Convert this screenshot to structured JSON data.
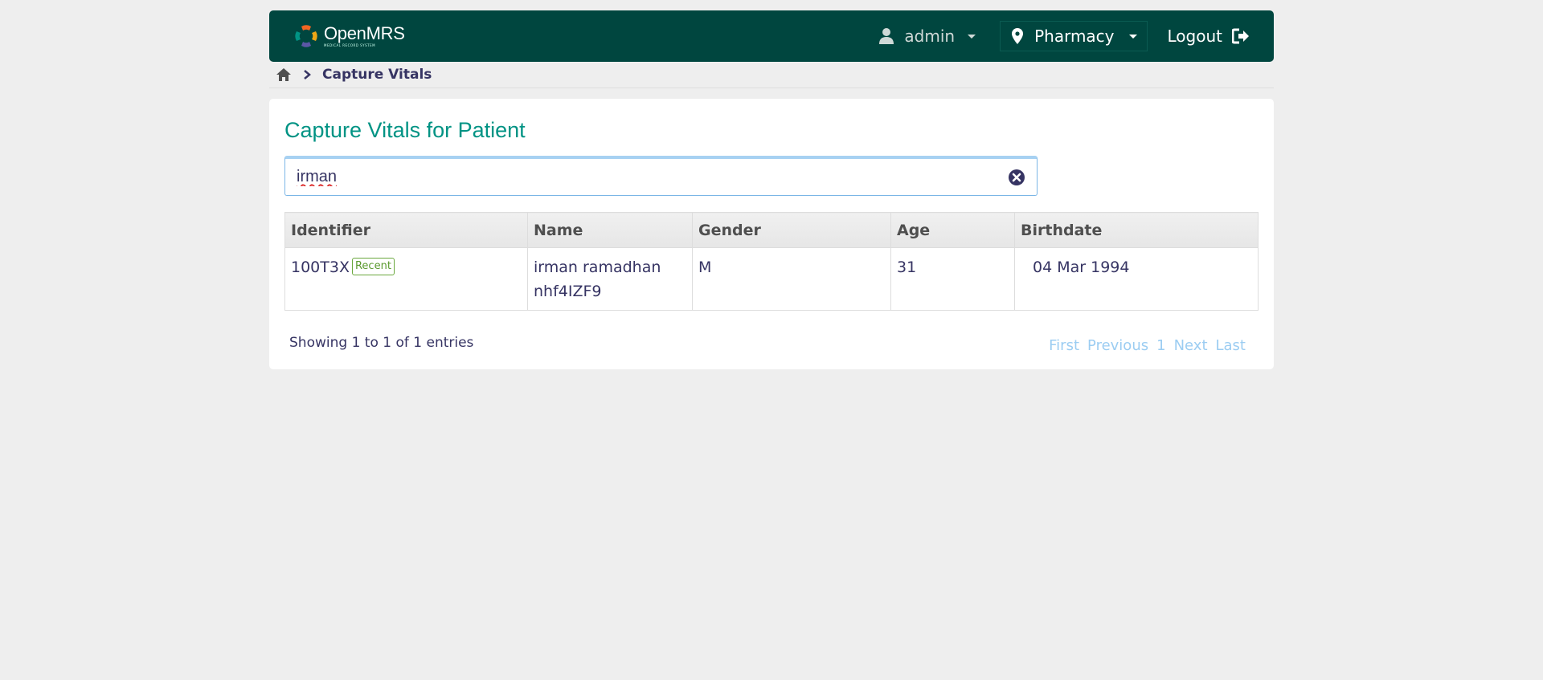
{
  "header": {
    "logo_name": "OpenMRS",
    "logo_tagline": "MEDICAL RECORD SYSTEM",
    "user": "admin",
    "location": "Pharmacy",
    "logout": "Logout"
  },
  "breadcrumb": {
    "current": "Capture Vitals"
  },
  "page": {
    "title": "Capture Vitals for Patient"
  },
  "search": {
    "value": "irman"
  },
  "table": {
    "headers": {
      "identifier": "Identifier",
      "name": "Name",
      "gender": "Gender",
      "age": "Age",
      "birthdate": "Birthdate"
    },
    "rows": [
      {
        "identifier": "100T3X",
        "badge": "Recent",
        "name_line1": "irman ramadhan",
        "name_line2": "nhf4IZF9",
        "gender": "M",
        "age": "31",
        "birthdate": "04 Mar 1994"
      }
    ]
  },
  "footer": {
    "info": "Showing 1 to 1 of 1 entries",
    "pager": {
      "first": "First",
      "previous": "Previous",
      "page": "1",
      "next": "Next",
      "last": "Last"
    }
  },
  "colors": {
    "header_bg": "#00463f",
    "title": "#009384",
    "text": "#363463",
    "background": "#eeeeee"
  }
}
